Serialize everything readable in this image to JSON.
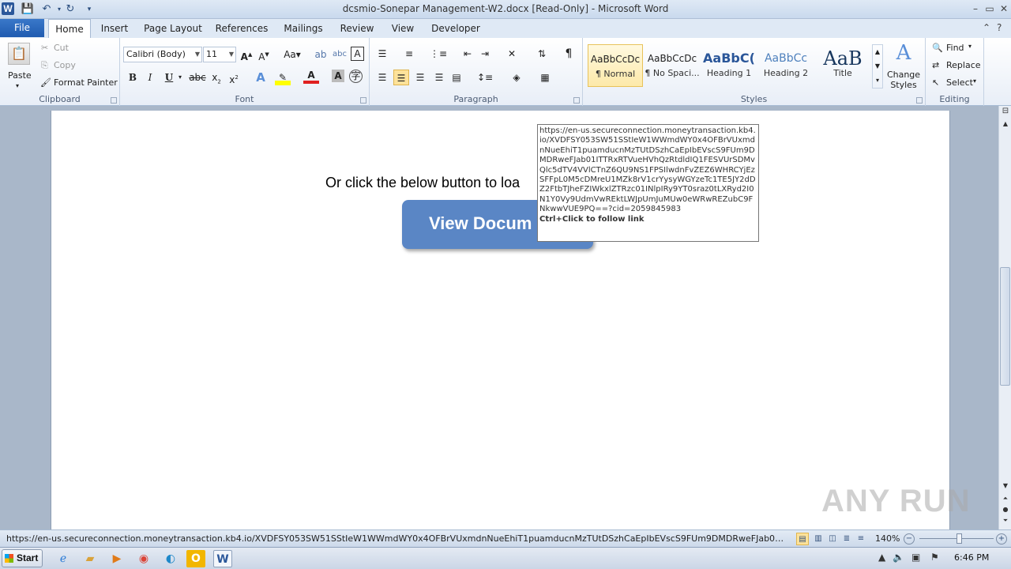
{
  "window": {
    "title": "dcsmio-Sonepar Management-W2.docx [Read-Only]  -  Microsoft Word",
    "app_icon_letter": "W",
    "qat": {
      "save_icon": "save-icon",
      "undo_icon": "undo-icon",
      "redo_icon": "redo-icon"
    },
    "controls": {
      "minimize": "–",
      "maximize": "▭",
      "close": "✕"
    }
  },
  "tabs": {
    "file": "File",
    "items": [
      "Home",
      "Insert",
      "Page Layout",
      "References",
      "Mailings",
      "Review",
      "View",
      "Developer"
    ],
    "active": "Home"
  },
  "ribbon": {
    "clipboard": {
      "label": "Clipboard",
      "paste": "Paste",
      "cut": "Cut",
      "copy": "Copy",
      "format_painter": "Format Painter"
    },
    "font": {
      "label": "Font",
      "family": "Calibri (Body)",
      "size": "11"
    },
    "paragraph": {
      "label": "Paragraph"
    },
    "styles": {
      "label": "Styles",
      "items": [
        {
          "preview": "AaBbCcDc",
          "name": "¶ Normal"
        },
        {
          "preview": "AaBbCcDc",
          "name": "¶ No Spaci..."
        },
        {
          "preview": "AaBbC(",
          "name": "Heading 1"
        },
        {
          "preview": "AaBbCc",
          "name": "Heading 2"
        },
        {
          "preview": "AaB",
          "name": "Title"
        }
      ],
      "change_styles": "Change Styles"
    },
    "editing": {
      "label": "Editing",
      "find": "Find",
      "replace": "Replace",
      "select": "Select"
    }
  },
  "document": {
    "body_text": "Or click the below button to loa",
    "button_text": "View Docum",
    "tooltip_url": "https://en-us.secureconnection.moneytransaction.kb4.io/XVDFSY053SW51SStIeW1WWmdWY0x4OFBrVUxmdnNueEhiT1puamducnMzTUtDSzhCaEpIbEVscS9FUm9DMDRweFJab01ITTRxRTVueHVhQzRtdldIQ1FESVUrSDMvQlc5dTV4VVlCTnZ6QU9NS1FPSIlwdnFvZEZ6WHRCYjEzSFFpL0M5cDMreU1MZk8rV1crYysyWGYzeTc1TE5JY2dDZ2FtbTJheFZIWkxlZTRzc01INlpIRy9YT0sraz0tLXRyd2I0N1Y0Vy9UdmVwREktLWJpUmJuMUw0eWRwREZubC9FNkwwVUE9PQ==?cid=2059845983",
    "tooltip_hint": "Ctrl+Click to follow link"
  },
  "statusbar": {
    "url": "https://en-us.secureconnection.moneytransaction.kb4.io/XVDFSY053SW51SStIeW1WWmdWY0x4OFBrVUxmdnNueEhiT1puamducnMzTUtDSzhCaEpIbEVscS9FUm9DMDRweFJab01ITTRxRTVueH...",
    "zoom": "140%",
    "zoom_out": "−",
    "zoom_in": "+"
  },
  "watermark": "ANY RUN",
  "taskbar": {
    "start": "Start",
    "apps": [
      "internet-explorer-icon",
      "file-explorer-icon",
      "media-player-icon",
      "chrome-icon",
      "edge-icon",
      "outlook-icon",
      "word-icon"
    ],
    "clock": "6:46 PM"
  }
}
